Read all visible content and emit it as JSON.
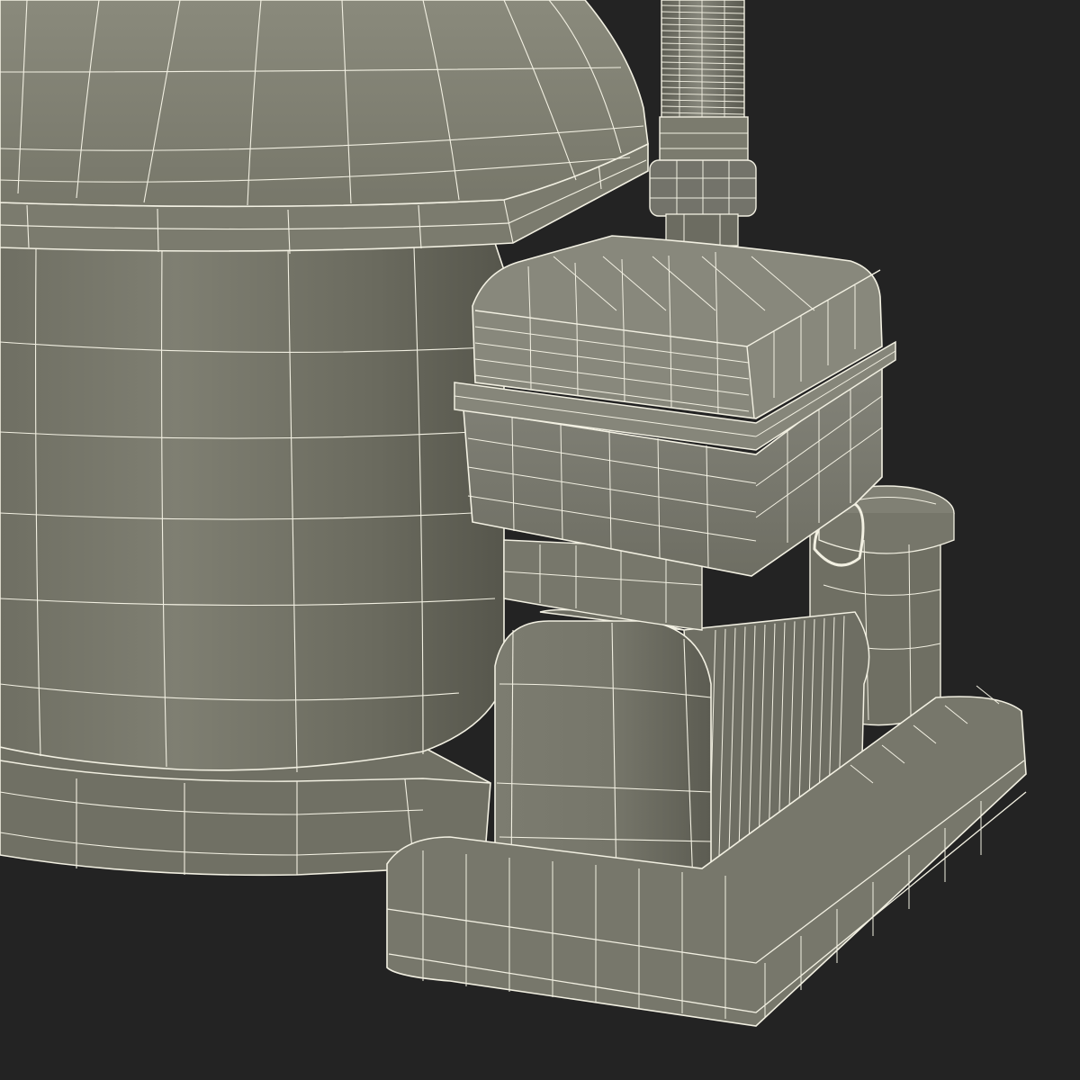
{
  "scene": {
    "background_color": "#232323",
    "surface_color": "#7d7d70",
    "wire_color": "#f2f0e2",
    "shadow_color": "#4a4a42",
    "highlight_color": "#9a9a8c"
  },
  "objects": [
    {
      "name": "filter-tank",
      "icon": "tank-shape"
    },
    {
      "name": "tank-dome-lid",
      "icon": "dome-shape"
    },
    {
      "name": "tank-base-ring",
      "icon": "ring-shape"
    },
    {
      "name": "hose-pipe",
      "icon": "pipe-shape"
    },
    {
      "name": "pipe-fitting",
      "icon": "fitting-shape"
    },
    {
      "name": "pump-housing",
      "icon": "pump-shape"
    },
    {
      "name": "pump-lid",
      "icon": "lid-shape"
    },
    {
      "name": "pump-motor",
      "icon": "motor-shape"
    },
    {
      "name": "pump-base-plate",
      "icon": "plate-shape"
    },
    {
      "name": "strainer-cylinder",
      "icon": "cylinder-shape"
    }
  ]
}
